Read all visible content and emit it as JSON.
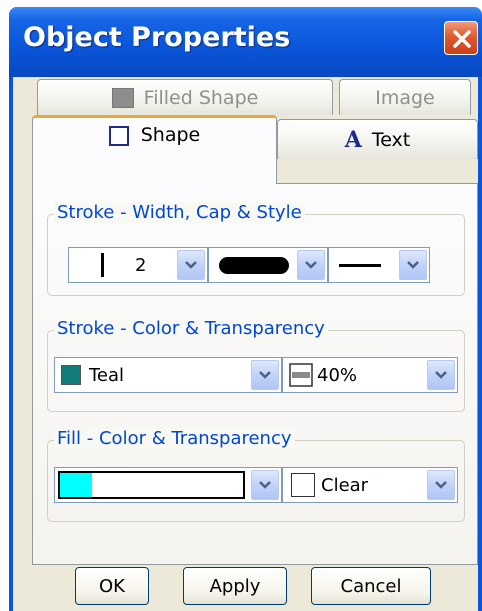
{
  "window": {
    "title": "Object Properties",
    "close_icon": "close-icon"
  },
  "tabs": {
    "back_row": [
      {
        "label": "Filled Shape",
        "icon": "filled-square-icon",
        "enabled": false
      },
      {
        "label": "Image",
        "enabled": false
      }
    ],
    "front_row": [
      {
        "label": "Shape",
        "icon": "square-outline-icon",
        "active": true
      },
      {
        "label": "Text",
        "icon": "text-A-icon",
        "active": false
      }
    ]
  },
  "stroke_style": {
    "group_label": "Stroke - Width, Cap & Style",
    "width_value": "2",
    "cap_icon": "round-cap-icon",
    "style_icon": "solid-line-icon"
  },
  "stroke_color": {
    "group_label": "Stroke - Color & Transparency",
    "color_name": "Teal",
    "color_hex": "#137b7b",
    "transparency": "40%"
  },
  "fill": {
    "group_label": "Fill - Color & Transparency",
    "color_hex": "#00ffff",
    "transparency": "Clear"
  },
  "buttons": {
    "ok": "OK",
    "apply": "Apply",
    "cancel": "Cancel"
  }
}
